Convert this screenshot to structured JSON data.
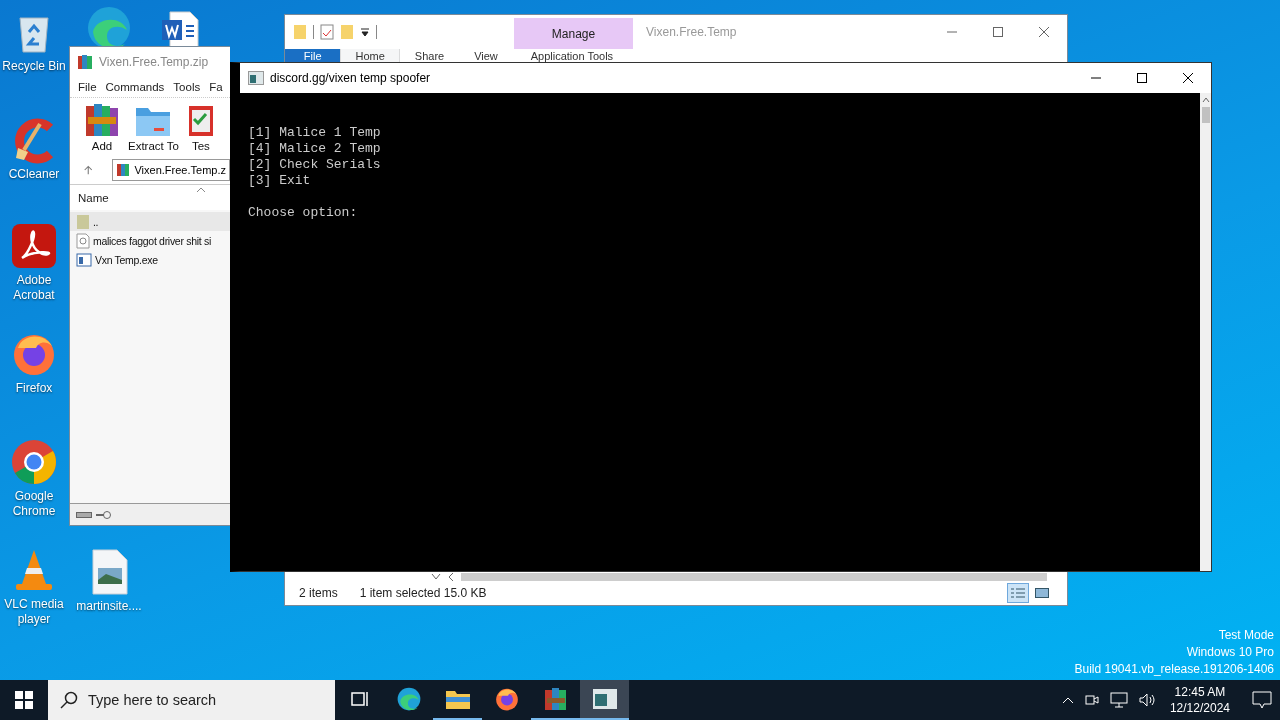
{
  "desktop_icons": [
    {
      "kind": "recycle",
      "label": "Recycle Bin"
    },
    {
      "kind": "edge"
    },
    {
      "kind": "word"
    },
    {
      "kind": "ccleaner",
      "label": "CCleaner"
    },
    {
      "kind": "acrobat",
      "label": "Adobe Acrobat"
    },
    {
      "kind": "firefox",
      "label": "Firefox"
    },
    {
      "kind": "chrome",
      "label": "Google Chrome"
    },
    {
      "kind": "vlc",
      "label": "VLC media player"
    },
    {
      "kind": "image",
      "label": "martinsite...."
    }
  ],
  "explorer": {
    "context_tab": "Manage",
    "title": "Vixen.Free.Temp",
    "file_button": "File",
    "tabs": [
      {
        "label": "Home",
        "selected": true
      },
      {
        "label": "Share",
        "selected": false
      },
      {
        "label": "View",
        "selected": false
      },
      {
        "label": "Application Tools",
        "selected": false
      }
    ],
    "status": {
      "items": "2 items",
      "selection": "1 item selected",
      "size": "15.0 KB"
    },
    "views": [
      {
        "kind": "details",
        "selected": true
      },
      {
        "kind": "icons",
        "selected": false
      }
    ]
  },
  "winrar": {
    "title": "Vixen.Free.Temp.zip",
    "menu": [
      "File",
      "Commands",
      "Tools",
      "Fa"
    ],
    "toolbar": [
      {
        "kind": "add",
        "label": "Add"
      },
      {
        "kind": "extract",
        "label": "Extract To"
      },
      {
        "kind": "test",
        "label": "Tes"
      }
    ],
    "address": "Vixen.Free.Temp.z",
    "column": "Name",
    "files": [
      {
        "kind": "folder",
        "name": "..",
        "selected": true
      },
      {
        "kind": "text",
        "name": "malices faggot driver shit si",
        "selected": false
      },
      {
        "kind": "exe",
        "name": "Vxn Temp.exe",
        "selected": false
      }
    ]
  },
  "console": {
    "title": "discord.gg/vixen temp spoofer",
    "lines": [
      "[1] Malice 1 Temp",
      "[4] Malice 2 Temp",
      "[2] Check Serials",
      "[3] Exit"
    ],
    "prompt": "Choose option:"
  },
  "system_notice": [
    "Test Mode",
    "Windows 10 Pro",
    "Build 19041.vb_release.191206-1406"
  ],
  "taskbar": {
    "search": {
      "placeholder": "Type here to search"
    },
    "apps": [
      {
        "kind": "taskview",
        "running": false,
        "selected": false
      },
      {
        "kind": "edge",
        "running": false,
        "selected": false
      },
      {
        "kind": "explorer",
        "running": true,
        "selected": false
      },
      {
        "kind": "firefox",
        "running": false,
        "selected": false
      },
      {
        "kind": "winrar",
        "running": true,
        "selected": false
      },
      {
        "kind": "console",
        "running": true,
        "selected": true
      }
    ],
    "time": "12:45 AM",
    "date": "12/12/2024"
  }
}
